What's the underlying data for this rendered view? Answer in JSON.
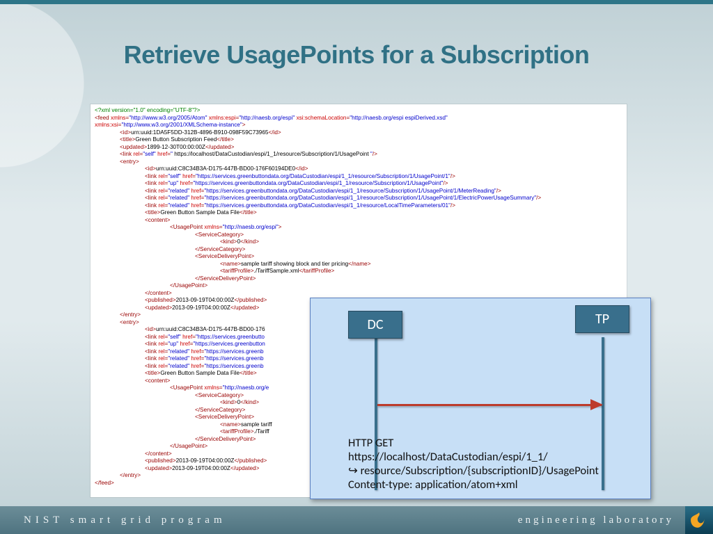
{
  "title": "Retrieve UsagePoints for a Subscription",
  "diagram": {
    "dc": "DC",
    "tp": "TP",
    "caption1": "HTTP GET",
    "caption2": "https://localhost/DataCustodian/espi/1_1/",
    "caption3": "resource/Subscription/{subscriptionID}/UsagePoint",
    "caption4": "Content-type: application/atom+xml"
  },
  "footer": {
    "left": "NIST smart grid program",
    "right": "engineering laboratory"
  },
  "xml": {
    "decl": "<?xml version=\"1.0\" encoding=\"UTF-8\"?>",
    "feed_open": {
      "tag": "feed",
      "attrs": [
        [
          "xmlns",
          "http://www.w3.org/2005/Atom"
        ],
        [
          "xmlns:espi",
          "http://naesb.org/espi"
        ],
        [
          "xsi:schemaLocation",
          "http://naesb.org/espi espiDerived.xsd"
        ],
        [
          "xmlns:xsi",
          "http://www.w3.org/2001/XMLSchema-instance"
        ]
      ]
    },
    "feed_id": "urn:uuid:1DA5F5DD-312B-4896-B910-098F59C73965",
    "feed_title": "Green Button Subscription Feed",
    "feed_updated": "1899-12-30T00:00:00Z",
    "feed_linkself": " https://localhost/DataCustodian/espi/1_1/resource/Subscription/1/UsagePoint ",
    "entry1": {
      "id": "urn:uuid:C8C34B3A-D175-447B-BD00-176F60194DE0",
      "links": [
        [
          "self",
          "https://services.greenbuttondata.org/DataCustodian/espi/1_1/resource/Subscription/1/UsagePoint/1"
        ],
        [
          "up",
          "https://services.greenbuttondata.org/DataCustodian/espi/1_1/resource/Subscription/1/UsagePoint"
        ],
        [
          "related",
          "https://services.greenbuttondata.org/DataCustodian/espi/1_1/resource/Subscription/1/UsagePoint/1/MeterReading"
        ],
        [
          "related",
          "https://services.greenbuttondata.org/DataCustodian/espi/1_1/resource/Subscription/1/UsagePoint/1/ElectricPowerUsageSummary"
        ],
        [
          "related",
          "https://services.greenbuttondata.org/DataCustodian/espi/1_1/resource/LocalTimeParameters/01"
        ]
      ],
      "title": "Green Button Sample Data File",
      "usagepoint_ns": "http://naesb.org/espi",
      "kind": "0",
      "sdp_name": "sample tariff showing block and tier pricing",
      "tariff": "./TariffSample.xml",
      "published": "2013-09-19T04:00:00Z",
      "updated": "2013-09-19T04:00:00Z"
    },
    "entry2": {
      "id_prefix": "urn:uuid:C8C34B3A-D175-447B-BD00-176",
      "link_self": "https://services.greenbutto",
      "link_up": "https://services.greenbutton",
      "link_rel": "https://services.greenb",
      "title": "Green Button Sample Data File",
      "usagepoint_ns_prefix": "http://naesb.org/e",
      "kind": "0",
      "sdp_name_prefix": "sample tariff",
      "tariff_prefix": "./Tariff",
      "published": "2013-09-19T04:00:00Z",
      "updated": "2013-09-19T04:00:00Z"
    }
  }
}
